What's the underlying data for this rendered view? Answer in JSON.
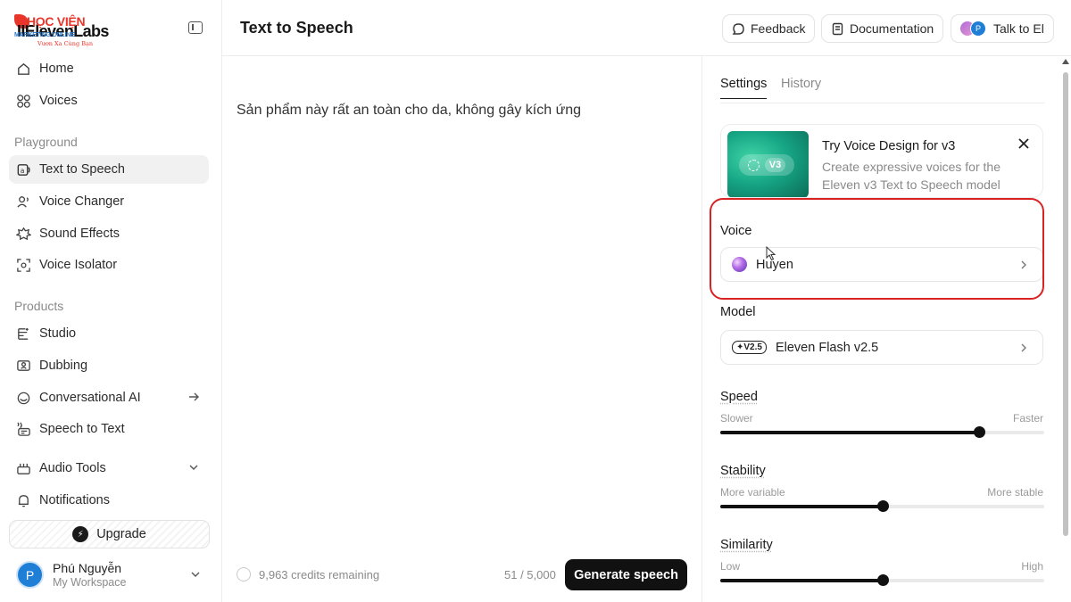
{
  "sidebar": {
    "logo": {
      "watermark_top": "HỌC VIỆN",
      "brand": "IIElevenLabs",
      "watermark_mid": "MARKETING ONLINE",
      "watermark_tag": "Vươn Xa Cùng Bạn"
    },
    "main_items": [
      {
        "label": "Home",
        "icon": "home-icon"
      },
      {
        "label": "Voices",
        "icon": "voices-icon"
      }
    ],
    "playground_label": "Playground",
    "playground_items": [
      {
        "label": "Text to Speech",
        "icon": "text-to-speech-icon",
        "active": true
      },
      {
        "label": "Voice Changer",
        "icon": "voice-changer-icon"
      },
      {
        "label": "Sound Effects",
        "icon": "sound-effects-icon"
      },
      {
        "label": "Voice Isolator",
        "icon": "voice-isolator-icon"
      }
    ],
    "products_label": "Products",
    "product_items": [
      {
        "label": "Studio",
        "icon": "studio-icon"
      },
      {
        "label": "Dubbing",
        "icon": "dubbing-icon"
      },
      {
        "label": "Conversational AI",
        "icon": "conversational-ai-icon"
      },
      {
        "label": "Speech to Text",
        "icon": "speech-to-text-icon"
      }
    ],
    "audio_tools": "Audio Tools",
    "notifications": "Notifications",
    "upgrade": "Upgrade",
    "user": {
      "initial": "P",
      "name": "Phú Nguyễn",
      "workspace": "My Workspace"
    }
  },
  "header": {
    "title": "Text to Speech",
    "feedback": "Feedback",
    "documentation": "Documentation",
    "talk": "Talk to El",
    "talk_avatar_initial": "P"
  },
  "editor": {
    "text": "Sản phẩm này rất an toàn cho da, không gây kích ứng",
    "credits": "9,963 credits remaining",
    "char_count": "51 / 5,000",
    "generate": "Generate speech"
  },
  "settings": {
    "tabs": [
      "Settings",
      "History"
    ],
    "promo": {
      "badge": "V3",
      "title": "Try Voice Design for v3",
      "description": "Create expressive voices for the Eleven v3 Text to Speech model"
    },
    "voice_label": "Voice",
    "voice_value": "Huyen",
    "model_label": "Model",
    "model_badge": "V2.5",
    "model_value": "Eleven Flash v2.5",
    "sliders": [
      {
        "label": "Speed",
        "min": "Slower",
        "max": "Faster",
        "value": 0.8
      },
      {
        "label": "Stability",
        "min": "More variable",
        "max": "More stable",
        "value": 0.5
      },
      {
        "label": "Similarity",
        "min": "Low",
        "max": "High",
        "value": 0.5
      }
    ]
  },
  "colors": {
    "accent": "#111111",
    "highlight": "#d92323",
    "promo": "#16a685"
  }
}
